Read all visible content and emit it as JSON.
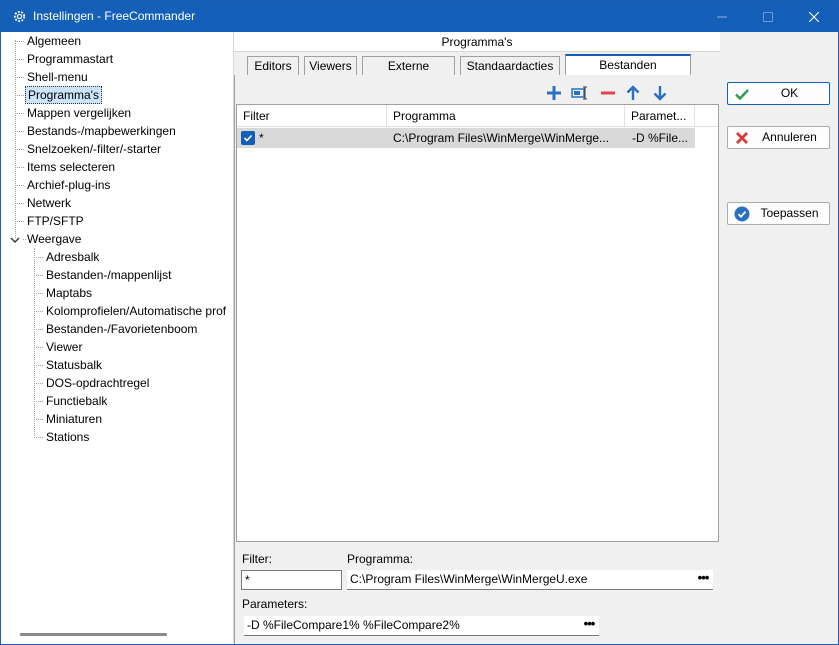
{
  "window": {
    "title": "Instellingen - FreeCommander",
    "controls": [
      "minimize",
      "maximize",
      "close"
    ]
  },
  "tree": {
    "items": [
      {
        "label": "Algemeen",
        "level": 0
      },
      {
        "label": "Programmastart",
        "level": 0
      },
      {
        "label": "Shell-menu",
        "level": 0
      },
      {
        "label": "Programma's",
        "level": 0,
        "selected": true
      },
      {
        "label": "Mappen vergelijken",
        "level": 0
      },
      {
        "label": "Bestands-/mapbewerkingen",
        "level": 0
      },
      {
        "label": "Snelzoeken/-filter/-starter",
        "level": 0
      },
      {
        "label": "Items selecteren",
        "level": 0
      },
      {
        "label": "Archief-plug-ins",
        "level": 0
      },
      {
        "label": "Netwerk",
        "level": 0
      },
      {
        "label": "FTP/SFTP",
        "level": 0
      },
      {
        "label": "Weergave",
        "level": 0,
        "expanded": true
      },
      {
        "label": "Adresbalk",
        "level": 1
      },
      {
        "label": "Bestanden-/mappenlijst",
        "level": 1
      },
      {
        "label": "Maptabs",
        "level": 1
      },
      {
        "label": "Kolomprofielen/Automatische prof",
        "level": 1
      },
      {
        "label": "Bestanden-/Favorietenboom",
        "level": 1
      },
      {
        "label": "Viewer",
        "level": 1
      },
      {
        "label": "Statusbalk",
        "level": 1
      },
      {
        "label": "DOS-opdrachtregel",
        "level": 1
      },
      {
        "label": "Functiebalk",
        "level": 1
      },
      {
        "label": "Miniaturen",
        "level": 1
      },
      {
        "label": "Stations",
        "level": 1
      }
    ]
  },
  "page": {
    "header": "Programma's",
    "tabs": [
      {
        "label": "Editors"
      },
      {
        "label": "Viewers"
      },
      {
        "label": "Externe viewers"
      },
      {
        "label": "Standaardacties"
      },
      {
        "label": "Bestanden vergelijken",
        "active": true
      }
    ],
    "toolbar": [
      "add-icon",
      "edit-icon",
      "remove-icon",
      "move-up-icon",
      "move-down-icon"
    ],
    "grid": {
      "columns": [
        "Filter",
        "Programma",
        "Paramet..."
      ],
      "rows": [
        {
          "checked": true,
          "filter": "*",
          "program": "C:\\Program Files\\WinMerge\\WinMerge...",
          "params": "-D %File..."
        }
      ]
    },
    "form": {
      "filter_label": "Filter:",
      "filter_value": "*",
      "program_label": "Programma:",
      "program_value": "C:\\Program Files\\WinMerge\\WinMergeU.exe",
      "params_label": "Parameters:",
      "params_value": "-D %FileCompare1% %FileCompare2%",
      "browse_label": "•••"
    }
  },
  "buttons": {
    "ok": "OK",
    "cancel": "Annuleren",
    "apply": "Toepassen"
  },
  "colors": {
    "accent": "#1460b8",
    "ok_check": "#2e9a4a",
    "cancel_x": "#d83b3b",
    "toolbar_blue": "#2b6fc2",
    "toolbar_red": "#e04848"
  }
}
